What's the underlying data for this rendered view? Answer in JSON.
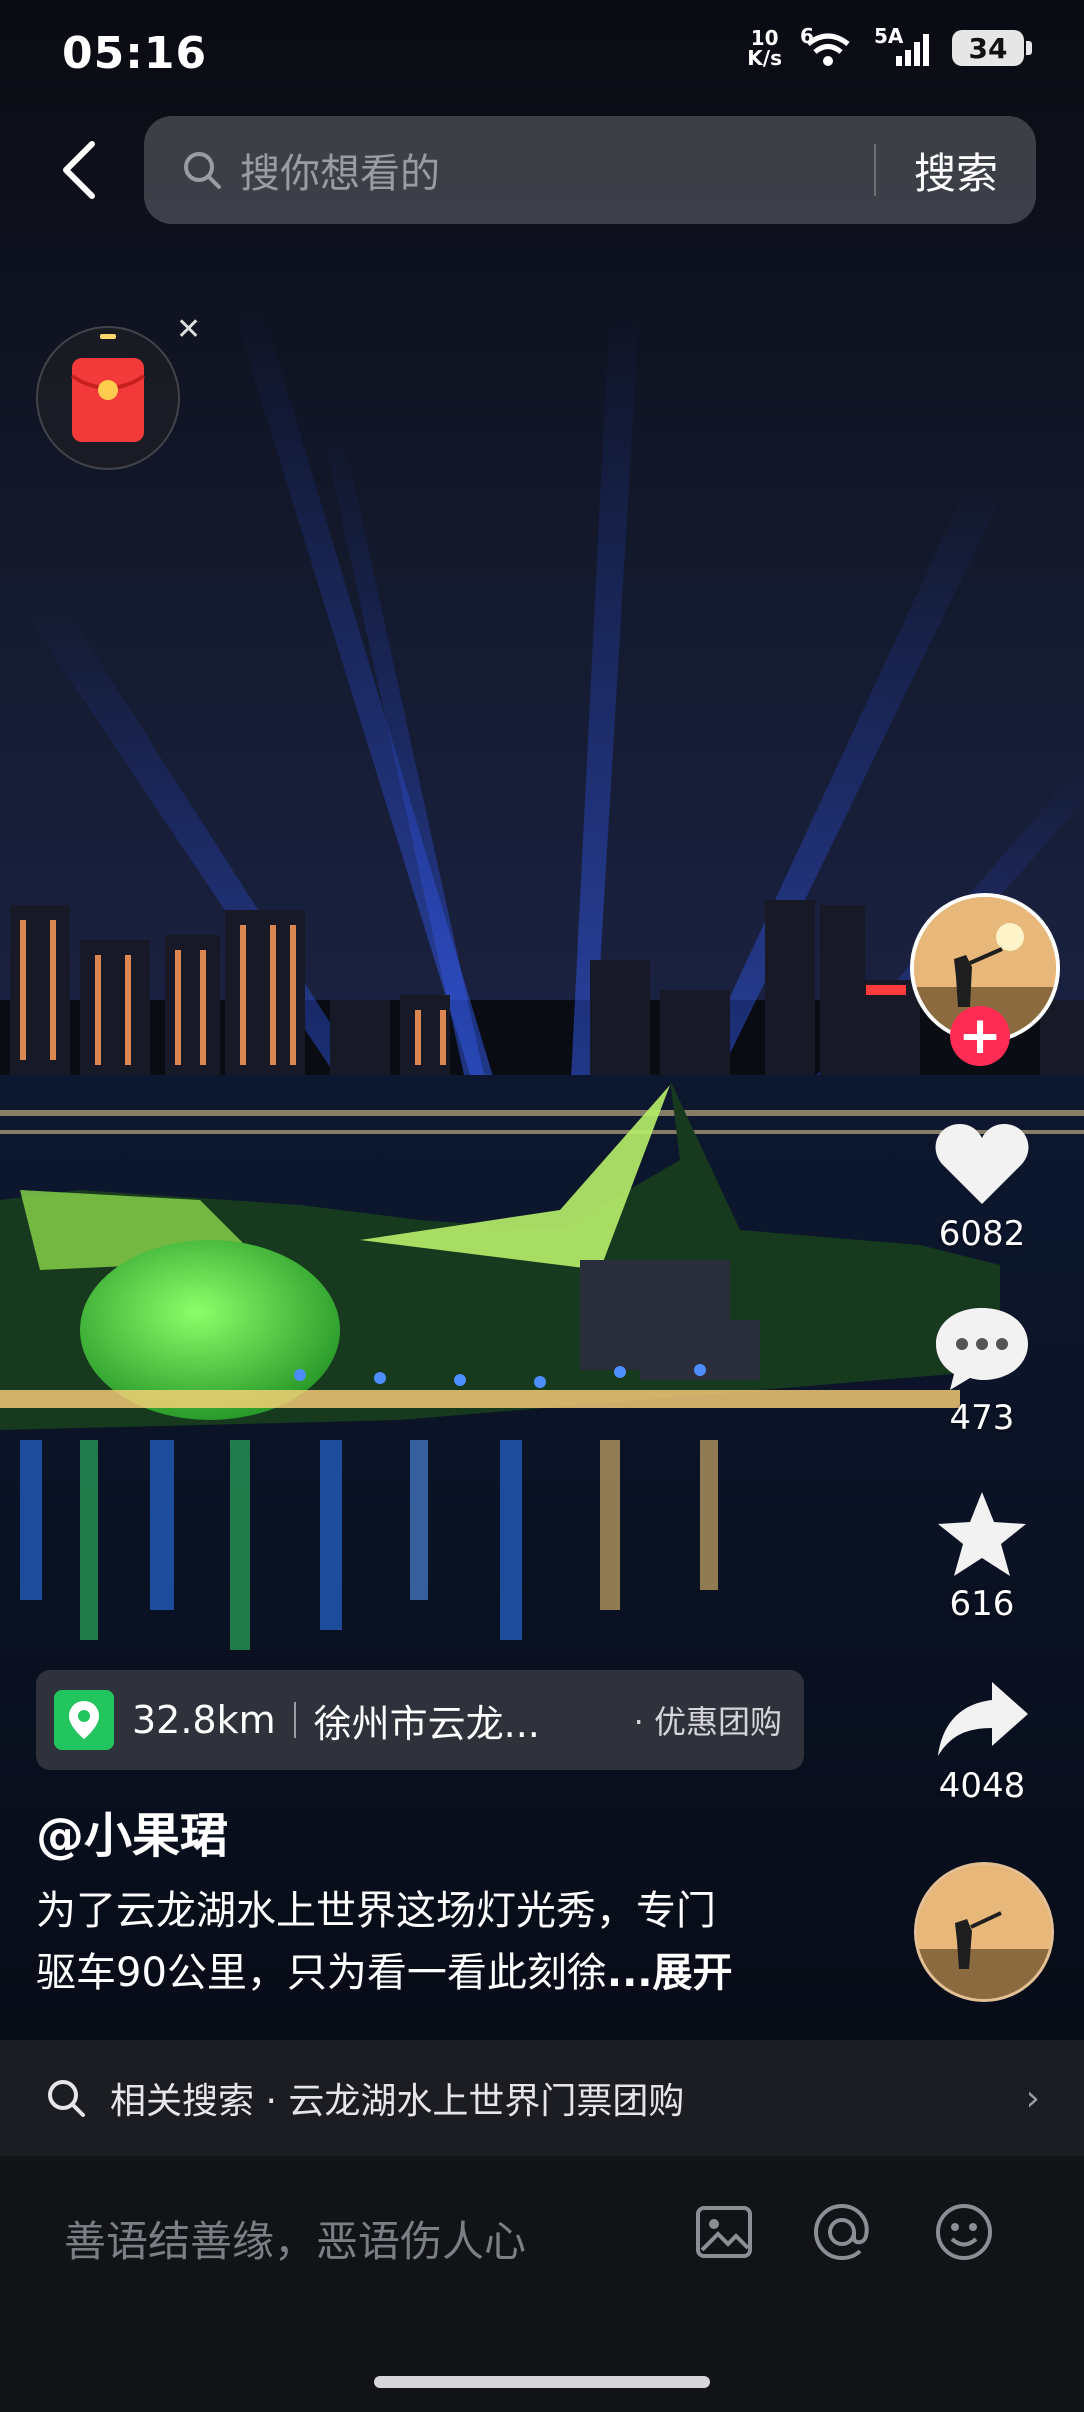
{
  "status": {
    "time": "05:16",
    "netspeed_value": "10",
    "netspeed_unit": "K/s",
    "wifi_label": "6",
    "signal_label": "5A",
    "battery": "34"
  },
  "search": {
    "placeholder": "搜你想看的",
    "button": "搜索"
  },
  "rail": {
    "likes": "6082",
    "comments": "473",
    "favorites": "616",
    "shares": "4048"
  },
  "location": {
    "distance": "32.8km",
    "name": "徐州市云龙...",
    "deal": "· 优惠团购"
  },
  "author": "@小果珺",
  "description": {
    "line1": "为了云龙湖水上世界这场灯光秀，专门",
    "line2": "驱车90公里，只为看一看此刻徐",
    "more": "...展开"
  },
  "related": {
    "text": "相关搜索 · 云龙湖水上世界门票团购",
    "arrow": "›"
  },
  "comment": {
    "placeholder": "善语结善缘，恶语伤人心"
  },
  "colors": {
    "accent_red": "#fe2c55",
    "location_green": "#22c55e"
  }
}
